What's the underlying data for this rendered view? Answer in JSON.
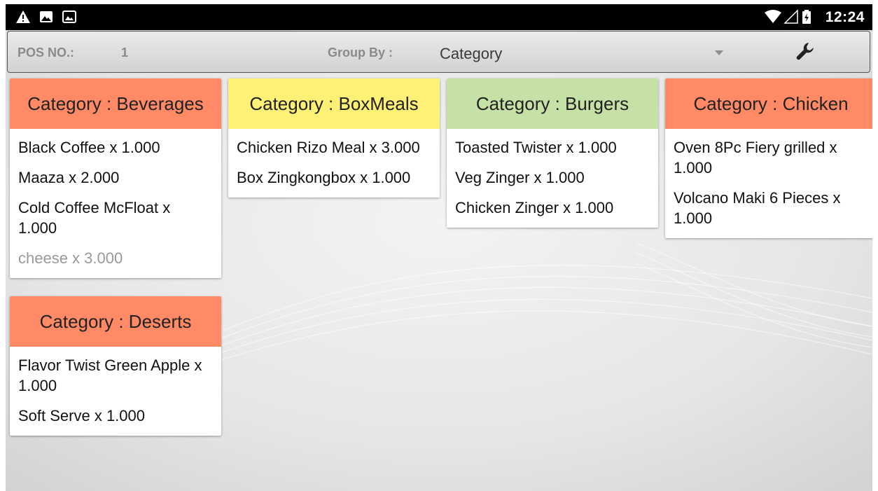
{
  "status_bar": {
    "time": "12:24",
    "left_icons": [
      "warning-icon",
      "image-icon",
      "photo-icon"
    ],
    "right_icons": [
      "wifi-icon",
      "signal-icon",
      "battery-icon"
    ]
  },
  "toolbar": {
    "pos_label": "POS NO.:",
    "pos_value": "1",
    "group_by_label": "Group By :",
    "group_by_value": "Category",
    "settings_icon": "wrench-icon"
  },
  "colors": {
    "orange": "#ff8a65",
    "yellow": "#fff176",
    "green": "#c5e1a5",
    "muted_text": "#9a9a9a"
  },
  "categories": [
    {
      "title": "Category : Beverages",
      "color": "#ff8a65",
      "items": [
        {
          "text": "Black Coffee x 1.000",
          "muted": false
        },
        {
          "text": "Maaza x 2.000",
          "muted": false
        },
        {
          "text": "Cold Coffee McFloat x 1.000",
          "muted": false
        },
        {
          "text": "cheese x 3.000",
          "muted": true
        }
      ]
    },
    {
      "title": "Category : BoxMeals",
      "color": "#fff176",
      "items": [
        {
          "text": "Chicken Rizo Meal x 3.000",
          "muted": false
        },
        {
          "text": "Box Zingkongbox x 1.000",
          "muted": false
        }
      ]
    },
    {
      "title": "Category : Burgers",
      "color": "#c5e1a5",
      "items": [
        {
          "text": "Toasted Twister x 1.000",
          "muted": false
        },
        {
          "text": "Veg  Zinger x 1.000",
          "muted": false
        },
        {
          "text": "Chicken Zinger x 1.000",
          "muted": false
        }
      ]
    },
    {
      "title": "Category : Chicken",
      "color": "#ff8a65",
      "items": [
        {
          "text": "Oven 8Pc Fiery grilled x 1.000",
          "muted": false
        },
        {
          "text": "Volcano Maki 6 Pieces x 1.000",
          "muted": false
        }
      ]
    },
    {
      "title": "Category : Deserts",
      "color": "#ff8a65",
      "items": [
        {
          "text": "Flavor Twist Green Apple x 1.000",
          "muted": false
        },
        {
          "text": "Soft Serve x 1.000",
          "muted": false
        }
      ]
    }
  ]
}
